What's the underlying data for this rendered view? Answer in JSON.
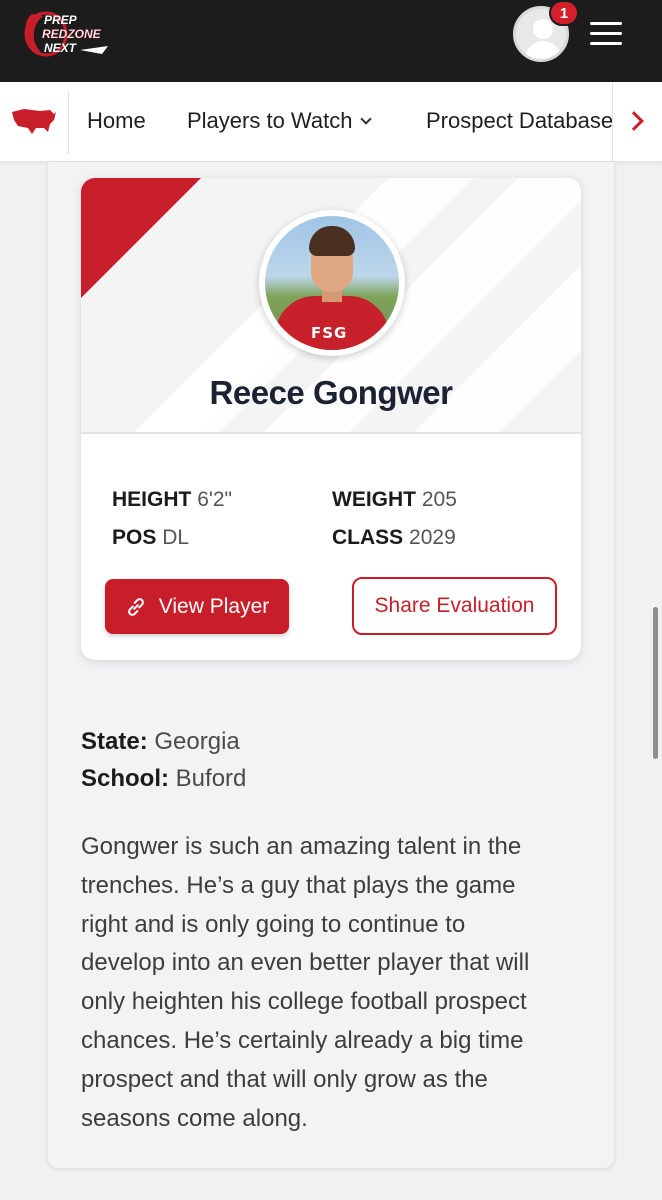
{
  "header": {
    "logo_lines": [
      "PREP",
      "REDZONE",
      "NEXT"
    ],
    "notification_count": "1"
  },
  "nav": {
    "items": [
      {
        "label": "Home"
      },
      {
        "label": "Players to Watch"
      },
      {
        "label": "Prospect Database"
      }
    ]
  },
  "player": {
    "name": "Reece Gongwer",
    "photo_shirt_text": "FSG",
    "stats": {
      "height_label": "HEIGHT",
      "height_value": "6'2\"",
      "weight_label": "WEIGHT",
      "weight_value": "205",
      "pos_label": "POS",
      "pos_value": "DL",
      "class_label": "CLASS",
      "class_value": "2029"
    },
    "view_button": "View Player",
    "share_button": "Share Evaluation"
  },
  "details": {
    "state_label": "State:",
    "state_value": "Georgia",
    "school_label": "School:",
    "school_value": "Buford"
  },
  "bio_lines": [
    "Gongwer is such an amazing talent in the",
    "trenches. He’s a guy that plays the game",
    "right and is only going to continue to",
    "develop into an even better player that will",
    "only heighten his college football prospect",
    "chances. He’s certainly already a big time",
    "prospect and that will only grow as the",
    "seasons come along."
  ],
  "colors": {
    "accent": "#c81e2a",
    "topbar": "#1c1c1c"
  }
}
